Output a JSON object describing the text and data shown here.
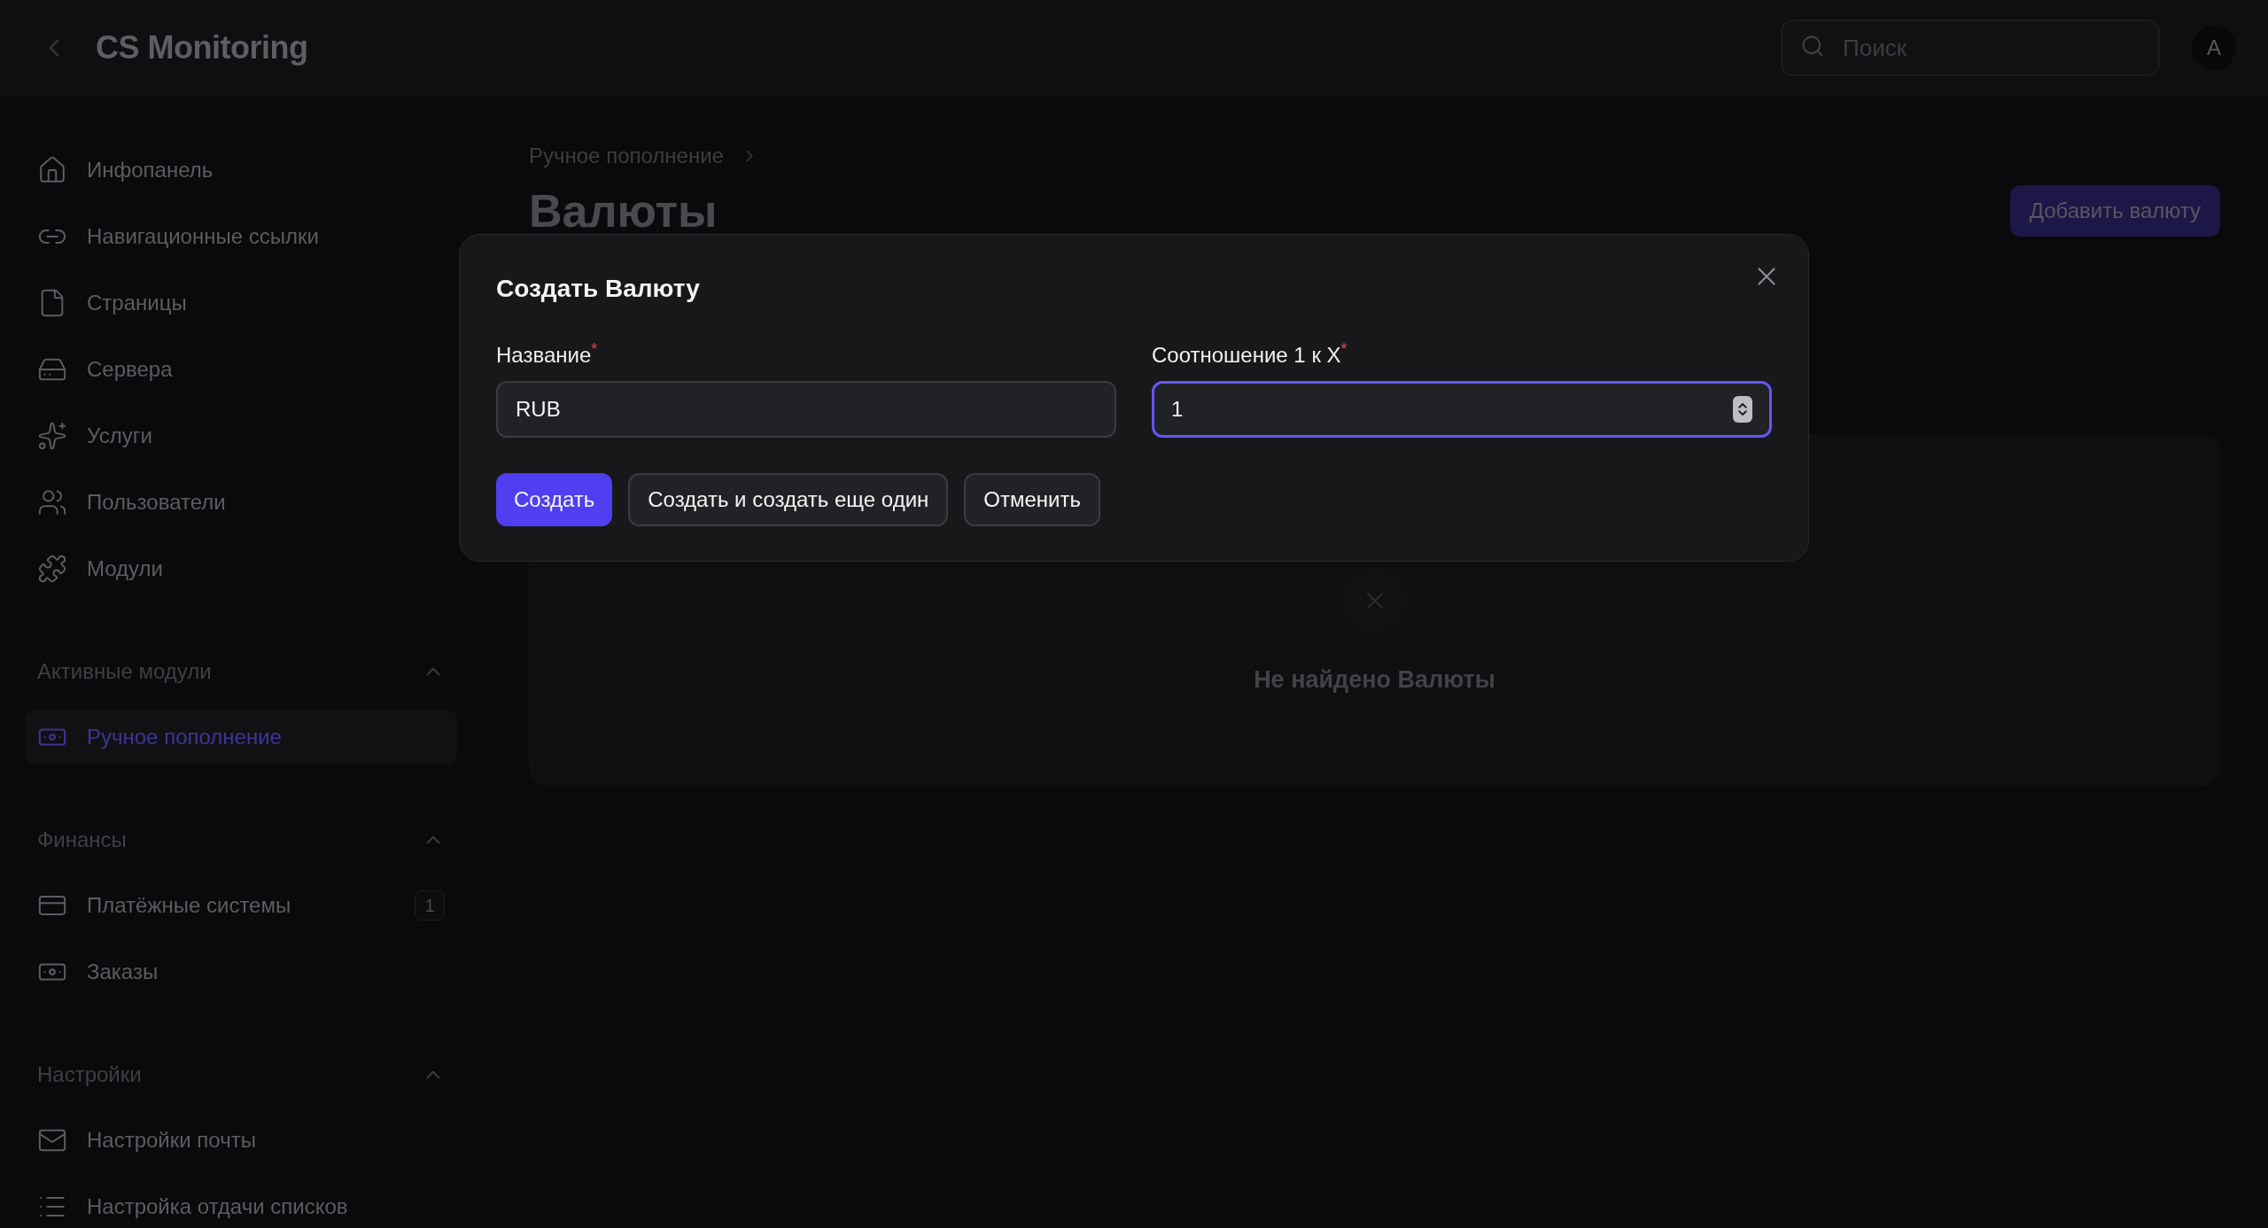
{
  "top_bar": {
    "title": "CS Monitoring",
    "search": {
      "placeholder": "Поиск"
    },
    "avatar": "A"
  },
  "sidebar": {
    "items": [
      {
        "label": "Инфопанель",
        "selected": false
      },
      {
        "label": "Навигационные ссылки",
        "selected": false
      },
      {
        "label": "Страницы",
        "selected": false
      },
      {
        "label": "Сервера",
        "selected": false
      },
      {
        "label": "Услуги",
        "selected": false
      },
      {
        "label": "Пользователи",
        "selected": false
      },
      {
        "label": "Модули",
        "selected": false
      }
    ],
    "sections": [
      {
        "title": "Активные модули",
        "expanded": true,
        "items": [
          {
            "label": "Ручное пополнение",
            "selected": true
          }
        ]
      },
      {
        "title": "Финансы",
        "expanded": true,
        "items": [
          {
            "label": "Платёжные системы",
            "selected": false,
            "badge": "1"
          },
          {
            "label": "Заказы",
            "selected": false
          }
        ]
      },
      {
        "title": "Настройки",
        "expanded": true,
        "items": [
          {
            "label": "Настройки почты",
            "selected": false
          },
          {
            "label": "Настройка отдачи списков",
            "selected": false
          }
        ]
      }
    ]
  },
  "page": {
    "breadcrumbs": [
      "Ручное пополнение"
    ],
    "title": "Валюты",
    "add_button": "Добавить валюту",
    "empty_state": "Не найдено Валюты"
  },
  "dialog": {
    "title": "Создать Валюту",
    "fields": [
      {
        "kind": "text",
        "label": "Название",
        "required_mark": "*",
        "value": "RUB",
        "focused": false
      },
      {
        "kind": "number",
        "label": "Соотношение 1 к X",
        "required_mark": "*",
        "value": "1",
        "focused": true
      }
    ],
    "buttons": [
      {
        "label": "Создать",
        "primary": true
      },
      {
        "label": "Создать и создать еще один",
        "primary": false
      },
      {
        "label": "Отменить",
        "primary": false
      }
    ]
  }
}
